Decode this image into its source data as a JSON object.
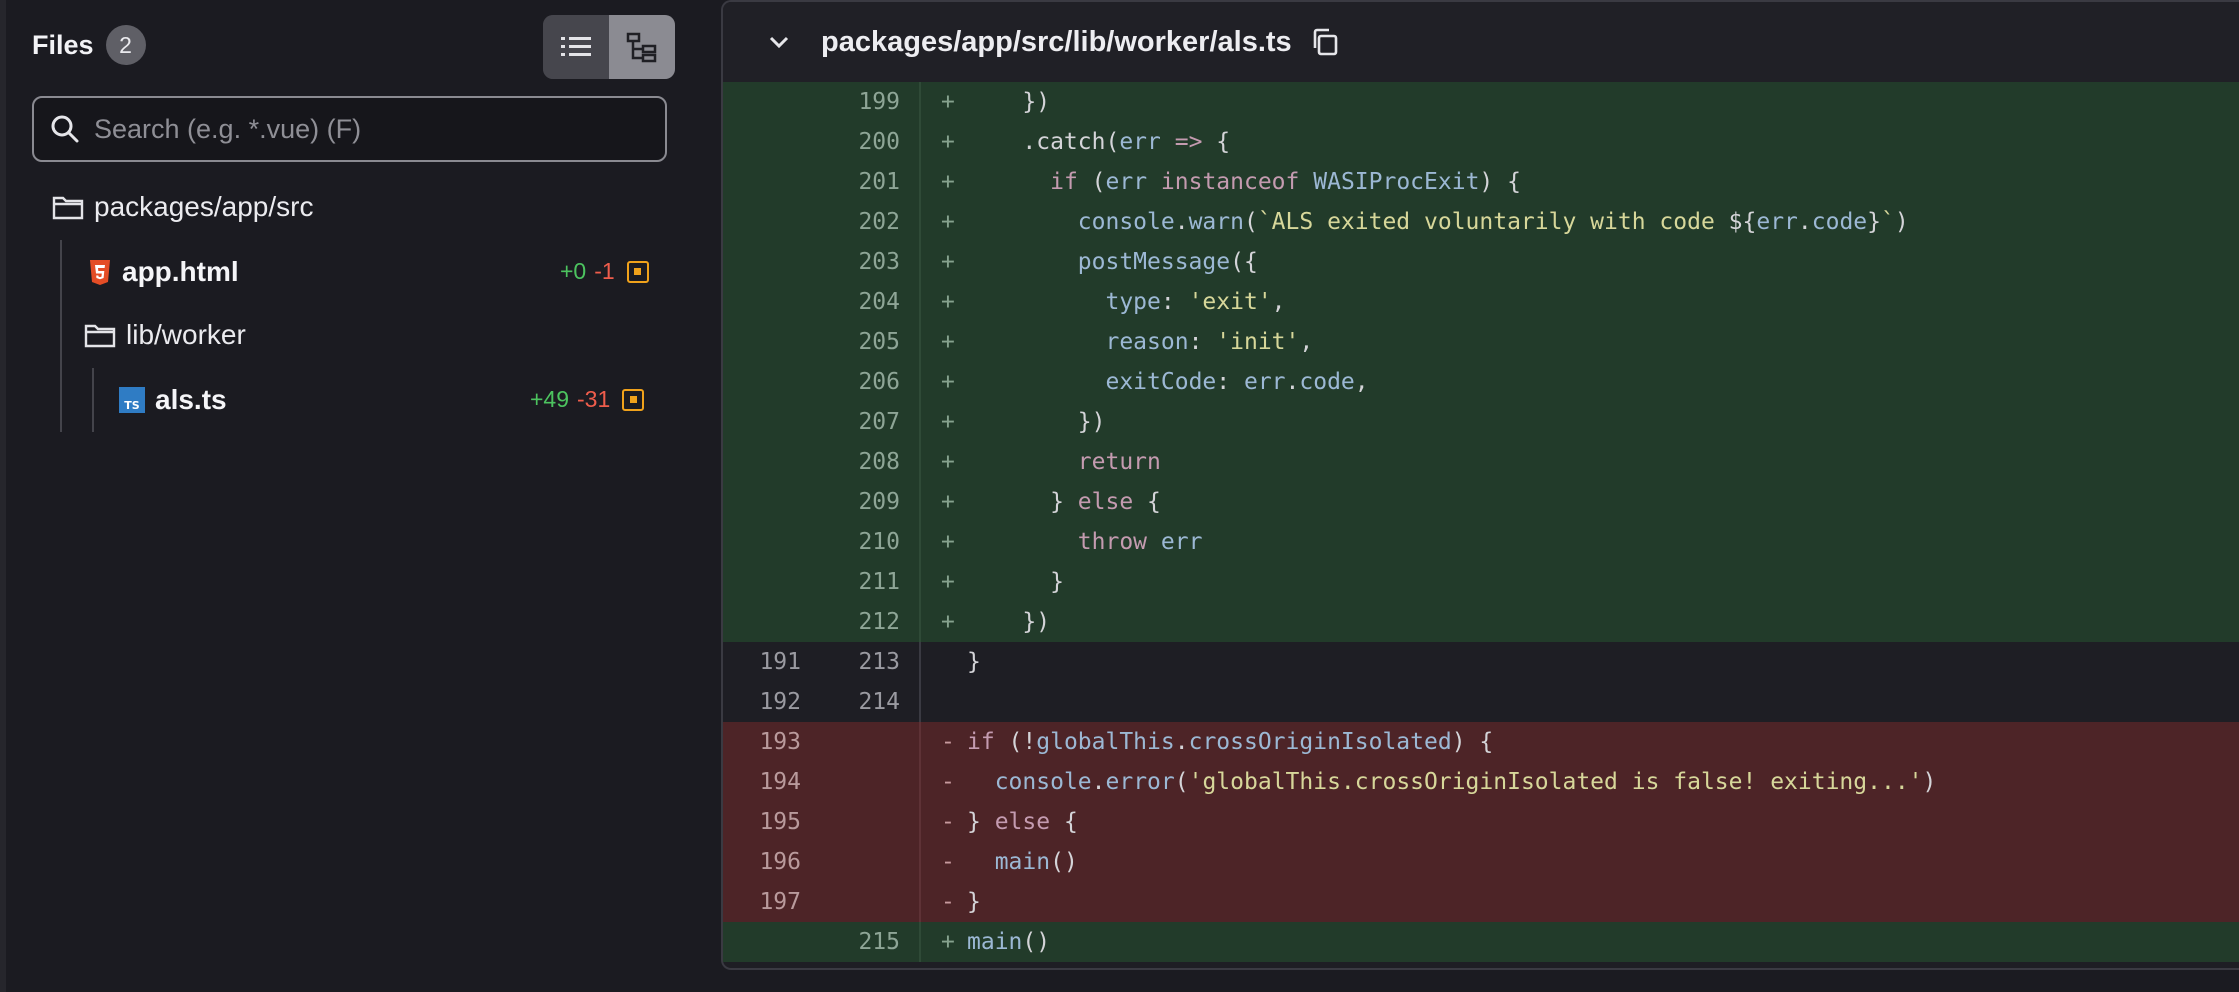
{
  "sidebar": {
    "title": "Files",
    "count": "2",
    "search_placeholder": "Search (e.g. *.vue) (F)",
    "tree": [
      {
        "label": "packages/app/src"
      },
      {
        "label": "app.html",
        "added": "+0",
        "removed": "-1"
      },
      {
        "label": "lib/worker"
      },
      {
        "label": "als.ts",
        "added": "+49",
        "removed": "-31"
      }
    ]
  },
  "diff": {
    "file_path": "packages/app/src/lib/worker/als.ts",
    "lines": [
      {
        "type": "add",
        "old": "",
        "new": "199",
        "sign": "+",
        "code": [
          [
            "pl",
            "    })"
          ]
        ]
      },
      {
        "type": "add",
        "old": "",
        "new": "200",
        "sign": "+",
        "code": [
          [
            "pl",
            "    .catch("
          ],
          [
            "id",
            "err"
          ],
          [
            "pl",
            " "
          ],
          [
            "kw",
            "=>"
          ],
          [
            "pl",
            " {"
          ]
        ]
      },
      {
        "type": "add",
        "old": "",
        "new": "201",
        "sign": "+",
        "code": [
          [
            "pl",
            "      "
          ],
          [
            "kw",
            "if"
          ],
          [
            "pl",
            " ("
          ],
          [
            "id",
            "err"
          ],
          [
            "pl",
            " "
          ],
          [
            "kw",
            "instanceof"
          ],
          [
            "pl",
            " "
          ],
          [
            "id",
            "WASIProcExit"
          ],
          [
            "pl",
            ") {"
          ]
        ]
      },
      {
        "type": "add",
        "old": "",
        "new": "202",
        "sign": "+",
        "code": [
          [
            "pl",
            "        "
          ],
          [
            "id",
            "console"
          ],
          [
            "pl",
            "."
          ],
          [
            "id",
            "warn"
          ],
          [
            "pl",
            "("
          ],
          [
            "str",
            "`ALS exited voluntarily with code "
          ],
          [
            "pl",
            "${"
          ],
          [
            "id",
            "err"
          ],
          [
            "pl",
            "."
          ],
          [
            "id",
            "code"
          ],
          [
            "pl",
            "}"
          ],
          [
            "str",
            "`"
          ],
          [
            "pl",
            ")"
          ]
        ]
      },
      {
        "type": "add",
        "old": "",
        "new": "203",
        "sign": "+",
        "code": [
          [
            "pl",
            "        "
          ],
          [
            "id",
            "postMessage"
          ],
          [
            "pl",
            "({"
          ]
        ]
      },
      {
        "type": "add",
        "old": "",
        "new": "204",
        "sign": "+",
        "code": [
          [
            "pl",
            "          "
          ],
          [
            "id",
            "type"
          ],
          [
            "pl",
            ": "
          ],
          [
            "str",
            "'exit'"
          ],
          [
            "pl",
            ","
          ]
        ]
      },
      {
        "type": "add",
        "old": "",
        "new": "205",
        "sign": "+",
        "code": [
          [
            "pl",
            "          "
          ],
          [
            "id",
            "reason"
          ],
          [
            "pl",
            ": "
          ],
          [
            "str",
            "'init'"
          ],
          [
            "pl",
            ","
          ]
        ]
      },
      {
        "type": "add",
        "old": "",
        "new": "206",
        "sign": "+",
        "code": [
          [
            "pl",
            "          "
          ],
          [
            "id",
            "exitCode"
          ],
          [
            "pl",
            ": "
          ],
          [
            "id",
            "err"
          ],
          [
            "pl",
            "."
          ],
          [
            "id",
            "code"
          ],
          [
            "pl",
            ","
          ]
        ]
      },
      {
        "type": "add",
        "old": "",
        "new": "207",
        "sign": "+",
        "code": [
          [
            "pl",
            "        })"
          ]
        ]
      },
      {
        "type": "add",
        "old": "",
        "new": "208",
        "sign": "+",
        "code": [
          [
            "pl",
            "        "
          ],
          [
            "kw",
            "return"
          ]
        ]
      },
      {
        "type": "add",
        "old": "",
        "new": "209",
        "sign": "+",
        "code": [
          [
            "pl",
            "      } "
          ],
          [
            "kw",
            "else"
          ],
          [
            "pl",
            " {"
          ]
        ]
      },
      {
        "type": "add",
        "old": "",
        "new": "210",
        "sign": "+",
        "code": [
          [
            "pl",
            "        "
          ],
          [
            "kw",
            "throw"
          ],
          [
            "pl",
            " "
          ],
          [
            "id",
            "err"
          ]
        ]
      },
      {
        "type": "add",
        "old": "",
        "new": "211",
        "sign": "+",
        "code": [
          [
            "pl",
            "      }"
          ]
        ]
      },
      {
        "type": "add",
        "old": "",
        "new": "212",
        "sign": "+",
        "code": [
          [
            "pl",
            "    })"
          ]
        ]
      },
      {
        "type": "ctx",
        "old": "191",
        "new": "213",
        "sign": "",
        "code": [
          [
            "pl",
            "}"
          ]
        ]
      },
      {
        "type": "ctx",
        "old": "192",
        "new": "214",
        "sign": "",
        "code": [
          [
            "pl",
            ""
          ]
        ]
      },
      {
        "type": "del",
        "old": "193",
        "new": "",
        "sign": "-",
        "code": [
          [
            "kw",
            "if"
          ],
          [
            "pl",
            " (!"
          ],
          [
            "id",
            "globalThis"
          ],
          [
            "pl",
            "."
          ],
          [
            "id",
            "crossOriginIsolated"
          ],
          [
            "pl",
            ") {"
          ]
        ]
      },
      {
        "type": "del",
        "old": "194",
        "new": "",
        "sign": "-",
        "code": [
          [
            "pl",
            "  "
          ],
          [
            "id",
            "console"
          ],
          [
            "pl",
            "."
          ],
          [
            "id",
            "error"
          ],
          [
            "pl",
            "("
          ],
          [
            "str",
            "'globalThis.crossOriginIsolated is false! exiting...'"
          ],
          [
            "pl",
            ")"
          ]
        ]
      },
      {
        "type": "del",
        "old": "195",
        "new": "",
        "sign": "-",
        "code": [
          [
            "pl",
            "} "
          ],
          [
            "kw",
            "else"
          ],
          [
            "pl",
            " {"
          ]
        ]
      },
      {
        "type": "del",
        "old": "196",
        "new": "",
        "sign": "-",
        "code": [
          [
            "pl",
            "  "
          ],
          [
            "id",
            "main"
          ],
          [
            "pl",
            "()"
          ]
        ]
      },
      {
        "type": "del",
        "old": "197",
        "new": "",
        "sign": "-",
        "code": [
          [
            "pl",
            "}"
          ]
        ]
      },
      {
        "type": "add",
        "old": "",
        "new": "215",
        "sign": "+",
        "code": [
          [
            "id",
            "main"
          ],
          [
            "pl",
            "()"
          ]
        ]
      }
    ]
  }
}
